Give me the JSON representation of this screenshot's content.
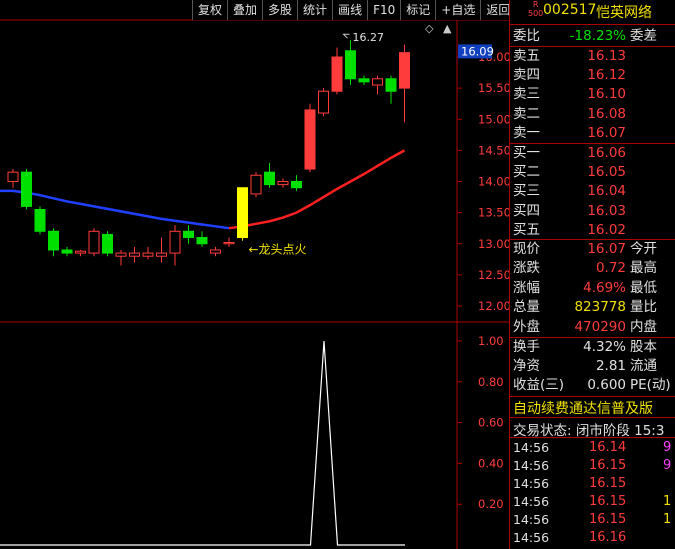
{
  "toolbar": {
    "items": [
      "复权",
      "叠加",
      "多股",
      "统计",
      "画线",
      "F10",
      "标记",
      "+自选",
      "返回"
    ]
  },
  "header": {
    "badge_top": "R",
    "badge_bottom": "500",
    "code": "002517",
    "name": "恺英网络"
  },
  "order_book": {
    "weibi_label": "委比",
    "weibi_value": "-18.23%",
    "weicha_label": "委差",
    "asks": [
      {
        "label": "卖五",
        "price": "16.13"
      },
      {
        "label": "卖四",
        "price": "16.12"
      },
      {
        "label": "卖三",
        "price": "16.10"
      },
      {
        "label": "卖二",
        "price": "16.08"
      },
      {
        "label": "卖一",
        "price": "16.07"
      }
    ],
    "bids": [
      {
        "label": "买一",
        "price": "16.06"
      },
      {
        "label": "买二",
        "price": "16.05"
      },
      {
        "label": "买三",
        "price": "16.04"
      },
      {
        "label": "买四",
        "price": "16.03"
      },
      {
        "label": "买五",
        "price": "16.02"
      }
    ]
  },
  "quote": {
    "rows": [
      {
        "label": "现价",
        "value": "16.07",
        "right": "今开",
        "color": "#ff3c3c"
      },
      {
        "label": "涨跌",
        "value": "0.72",
        "right": "最高",
        "color": "#ff3c3c"
      },
      {
        "label": "涨幅",
        "value": "4.69%",
        "right": "最低",
        "color": "#ff3c3c"
      },
      {
        "label": "总量",
        "value": "823778",
        "right": "量比",
        "color": "#f0e000"
      },
      {
        "label": "外盘",
        "value": "470290",
        "right": "内盘",
        "color": "#ff3c3c"
      }
    ],
    "rows2": [
      {
        "label": "换手",
        "value": "4.32%",
        "right": "股本"
      },
      {
        "label": "净资",
        "value": "2.81",
        "right": "流通"
      },
      {
        "label": "收益(三)",
        "value": "0.600",
        "right": "PE(动)"
      }
    ]
  },
  "banner": "自动续费通达信普及版",
  "trade_status": "交易状态: 闭市阶段 15:3",
  "ticks": [
    {
      "time": "14:56",
      "price": "16.14",
      "vol": "9",
      "color": "#ff40ff"
    },
    {
      "time": "14:56",
      "price": "16.15",
      "vol": "9",
      "color": "#ff40ff"
    },
    {
      "time": "14:56",
      "price": "16.15",
      "vol": "",
      "color": "#f0e000"
    },
    {
      "time": "14:56",
      "price": "16.15",
      "vol": "1",
      "color": "#f0e000"
    },
    {
      "time": "14:56",
      "price": "16.15",
      "vol": "1",
      "color": "#f0e000"
    },
    {
      "time": "14:56",
      "price": "16.16",
      "vol": "",
      "color": "#f0e000"
    }
  ],
  "chart_data": [
    {
      "type": "candlestick",
      "price_axis": {
        "ticks": [
          "16.00",
          "15.50",
          "15.00",
          "14.50",
          "14.00",
          "13.50",
          "13.00",
          "12.50",
          "12.00"
        ],
        "range": [
          11.8,
          16.4
        ]
      },
      "current_price_tag": "16.09",
      "high_annotation": "16.27",
      "signal_annotation": "←龙头点火",
      "candles": [
        {
          "o": 14.0,
          "h": 14.2,
          "l": 13.9,
          "c": 14.15,
          "up": true
        },
        {
          "o": 14.15,
          "h": 14.2,
          "l": 13.55,
          "c": 13.6,
          "up": false
        },
        {
          "o": 13.55,
          "h": 13.6,
          "l": 13.15,
          "c": 13.2,
          "up": false
        },
        {
          "o": 13.2,
          "h": 13.25,
          "l": 12.8,
          "c": 12.9,
          "up": false
        },
        {
          "o": 12.9,
          "h": 12.95,
          "l": 12.8,
          "c": 12.85,
          "up": false
        },
        {
          "o": 12.85,
          "h": 12.9,
          "l": 12.8,
          "c": 12.88,
          "up": true
        },
        {
          "o": 12.85,
          "h": 13.25,
          "l": 12.8,
          "c": 13.2,
          "up": true
        },
        {
          "o": 13.15,
          "h": 13.2,
          "l": 12.8,
          "c": 12.85,
          "up": false
        },
        {
          "o": 12.85,
          "h": 12.9,
          "l": 12.65,
          "c": 12.8,
          "up": true
        },
        {
          "o": 12.8,
          "h": 12.95,
          "l": 12.7,
          "c": 12.85,
          "up": true
        },
        {
          "o": 12.85,
          "h": 12.95,
          "l": 12.75,
          "c": 12.8,
          "up": true
        },
        {
          "o": 12.8,
          "h": 13.1,
          "l": 12.7,
          "c": 12.85,
          "up": true
        },
        {
          "o": 12.85,
          "h": 13.3,
          "l": 12.65,
          "c": 13.2,
          "up": true
        },
        {
          "o": 13.2,
          "h": 13.3,
          "l": 13.0,
          "c": 13.1,
          "up": false
        },
        {
          "o": 13.1,
          "h": 13.2,
          "l": 12.95,
          "c": 13.0,
          "up": false
        },
        {
          "o": 12.85,
          "h": 12.95,
          "l": 12.8,
          "c": 12.9,
          "up": true
        },
        {
          "o": 13.0,
          "h": 13.1,
          "l": 12.95,
          "c": 13.02,
          "up": true
        },
        {
          "o": 13.1,
          "h": 13.9,
          "l": 13.05,
          "c": 13.9,
          "up": true,
          "signal": true
        },
        {
          "o": 13.8,
          "h": 14.15,
          "l": 13.75,
          "c": 14.1,
          "up": true
        },
        {
          "o": 14.15,
          "h": 14.3,
          "l": 13.9,
          "c": 13.95,
          "up": false
        },
        {
          "o": 13.95,
          "h": 14.05,
          "l": 13.9,
          "c": 14.0,
          "up": true
        },
        {
          "o": 14.0,
          "h": 14.1,
          "l": 13.85,
          "c": 13.9,
          "up": false
        },
        {
          "o": 14.2,
          "h": 15.25,
          "l": 14.15,
          "c": 15.15,
          "up": true
        },
        {
          "o": 15.1,
          "h": 15.5,
          "l": 15.05,
          "c": 15.45,
          "up": true
        },
        {
          "o": 15.45,
          "h": 16.15,
          "l": 15.4,
          "c": 16.0,
          "up": true
        },
        {
          "o": 16.1,
          "h": 16.27,
          "l": 15.55,
          "c": 15.65,
          "up": false
        },
        {
          "o": 15.6,
          "h": 15.7,
          "l": 15.55,
          "c": 15.65,
          "up": false
        },
        {
          "o": 15.55,
          "h": 15.7,
          "l": 15.4,
          "c": 15.65,
          "up": true
        },
        {
          "o": 15.65,
          "h": 15.7,
          "l": 15.25,
          "c": 15.45,
          "up": false
        },
        {
          "o": 15.5,
          "h": 16.2,
          "l": 14.95,
          "c": 16.07,
          "up": true
        }
      ],
      "ma_blue": [
        13.85,
        13.85,
        13.82,
        13.78,
        13.73,
        13.68,
        13.64,
        13.6,
        13.56,
        13.52,
        13.48,
        13.44,
        13.4,
        13.37,
        13.34,
        13.31,
        13.28,
        13.25
      ],
      "ma_red": [
        13.25,
        13.28,
        13.32,
        13.36,
        13.42,
        13.5,
        13.62,
        13.75,
        13.88,
        14.0,
        14.12,
        14.25,
        14.38,
        14.5
      ]
    },
    {
      "type": "line",
      "y_axis": {
        "ticks": [
          "1.00",
          "0.80",
          "0.60",
          "0.40",
          "0.20"
        ],
        "range": [
          0,
          1.05
        ]
      },
      "values": [
        0,
        0,
        0,
        0,
        0,
        0,
        0,
        0,
        0,
        0,
        0,
        0,
        0,
        0,
        0,
        0,
        0,
        0,
        0,
        0,
        0,
        0,
        0,
        0,
        1,
        0,
        0,
        0,
        0,
        0,
        0
      ]
    }
  ]
}
